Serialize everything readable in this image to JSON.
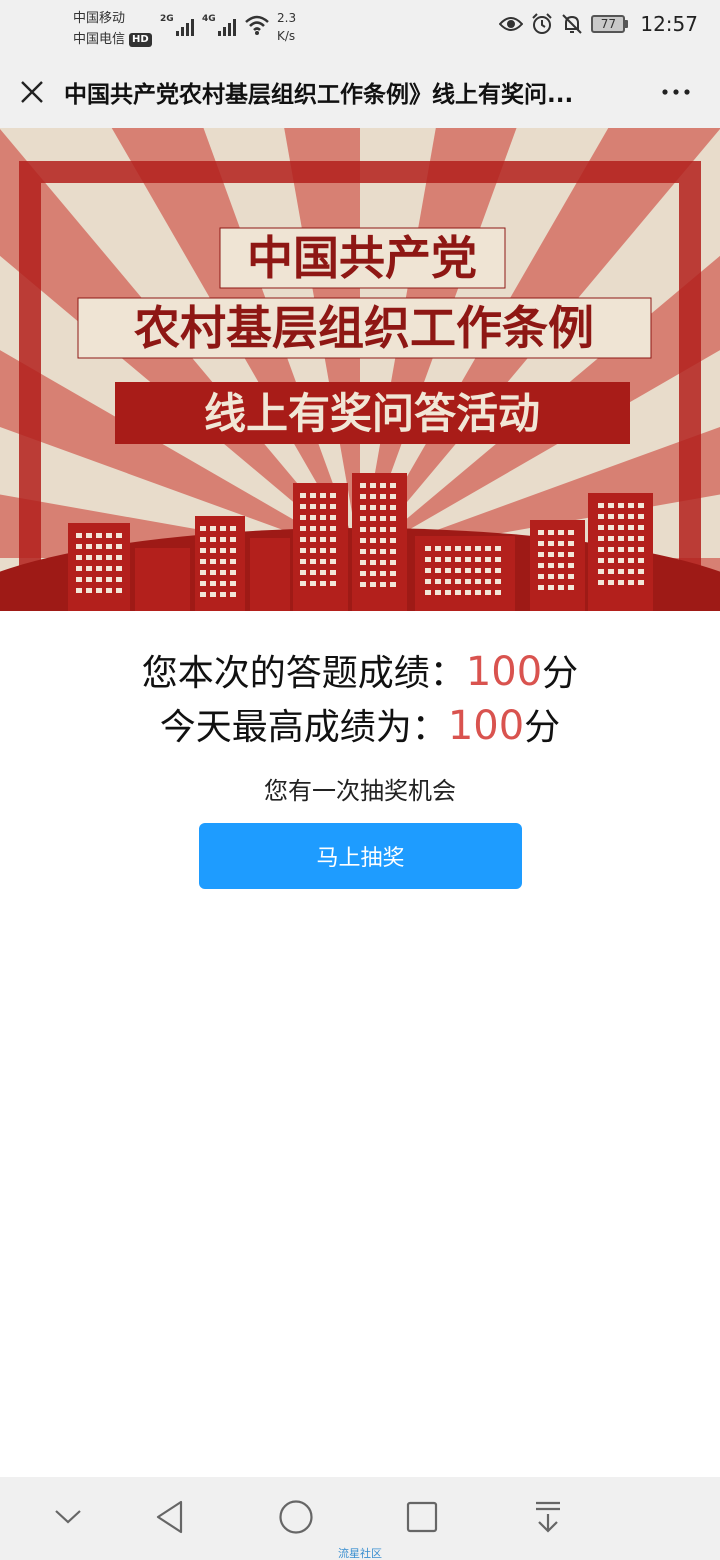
{
  "status_bar": {
    "carrier_1": "中国移动",
    "carrier_2": "中国电信",
    "hd_badge": "HD",
    "network_1": "2G",
    "network_2": "4G",
    "speed_value": "2.3",
    "speed_unit": "K/s",
    "battery": "77",
    "time": "12:57"
  },
  "title_bar": {
    "title": "中国共产党农村基层组织工作条例》线上有奖问...",
    "close_icon": "close-icon",
    "more_icon": "more-icon"
  },
  "banner": {
    "line1": "中国共产党",
    "line2": "农村基层组织工作条例",
    "line3": "线上有奖问答活动",
    "colors": {
      "red": "#b3201c",
      "dark_red": "#8e1714",
      "cream": "#e8dccb"
    }
  },
  "result": {
    "current_label": "您本次的答题成绩：",
    "current_score": "100",
    "current_unit": "分",
    "best_label": "今天最高成绩为：",
    "best_score": "100",
    "best_unit": "分",
    "chance_text": "您有一次抽奖机会",
    "draw_button": "马上抽奖",
    "accent": "#d9534f",
    "button_color": "#1e9cff"
  },
  "nav_bar": {
    "icons": [
      "chevron-down-icon",
      "back-triangle-icon",
      "home-circle-icon",
      "recents-square-icon",
      "pull-down-icon"
    ],
    "watermark": "流星社区"
  }
}
